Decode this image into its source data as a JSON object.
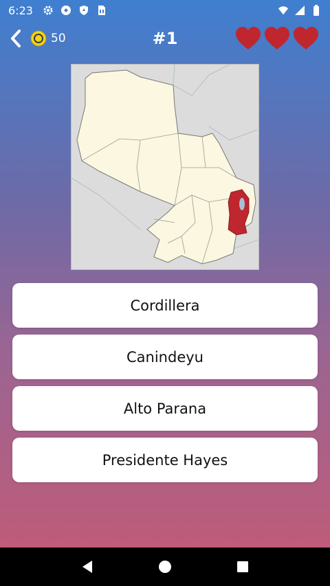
{
  "status_bar": {
    "time": "6:23",
    "left_icons": [
      "gear-icon",
      "sync-icon",
      "shield-icon",
      "sim-card-icon"
    ],
    "right_icons": [
      "wifi-icon",
      "signal-icon",
      "battery-icon"
    ]
  },
  "header": {
    "coins": "50",
    "level": "#1",
    "lives": 3,
    "coin_color": "#f2d41b",
    "heart_color": "#c0262d"
  },
  "question": {
    "map_highlight_color": "#c0262d",
    "map_land_color": "#fbf7e0",
    "map_background_color": "#dcdcdc"
  },
  "answers": [
    {
      "label": "Cordillera"
    },
    {
      "label": "Canindeyu"
    },
    {
      "label": "Alto Parana"
    },
    {
      "label": "Presidente Hayes"
    }
  ],
  "nav_bar": {
    "icons": [
      "back-triangle-icon",
      "home-circle-icon",
      "recents-square-icon"
    ]
  }
}
